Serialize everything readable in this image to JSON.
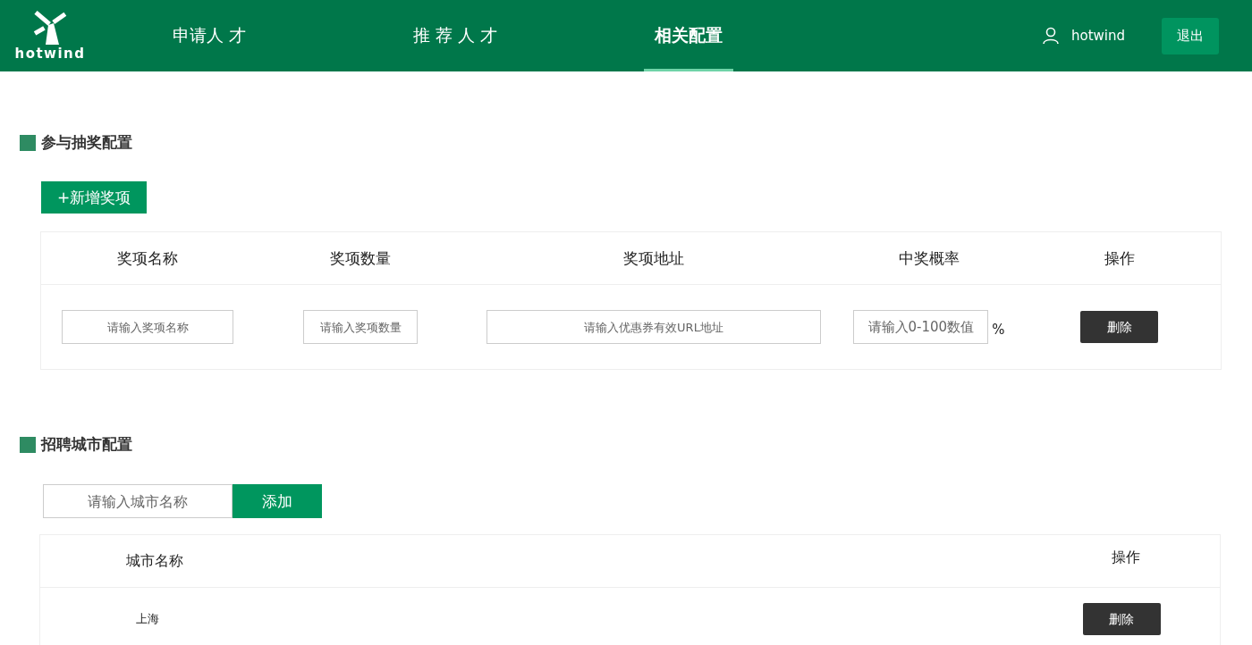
{
  "header": {
    "logo_text": "hotwind",
    "nav": [
      {
        "label": "申请人 才",
        "selected": false
      },
      {
        "label": "推 荐 人 才",
        "selected": false
      },
      {
        "label": "相关配置",
        "selected": true
      }
    ],
    "user": "hotwind",
    "logout": "退出"
  },
  "prize_section": {
    "title": "参与抽奖配置",
    "add_button": "+新增奖项",
    "columns": [
      "奖项名称",
      "奖项数量",
      "奖项地址",
      "中奖概率",
      "操作"
    ],
    "rows": [
      {
        "name_placeholder": "请输入奖项名称",
        "count_placeholder": "请输入奖项数量",
        "url_placeholder": "请输入优惠券有效URL地址",
        "rate_placeholder": "请输入0-100数值",
        "unit": "%",
        "action": "删除"
      }
    ]
  },
  "city_section": {
    "title": "招聘城市配置",
    "city_placeholder": "请输入城市名称",
    "add_button": "添加",
    "columns": [
      "城市名称",
      "操作"
    ],
    "rows": [
      {
        "city": "上海",
        "action": "删除"
      }
    ]
  }
}
